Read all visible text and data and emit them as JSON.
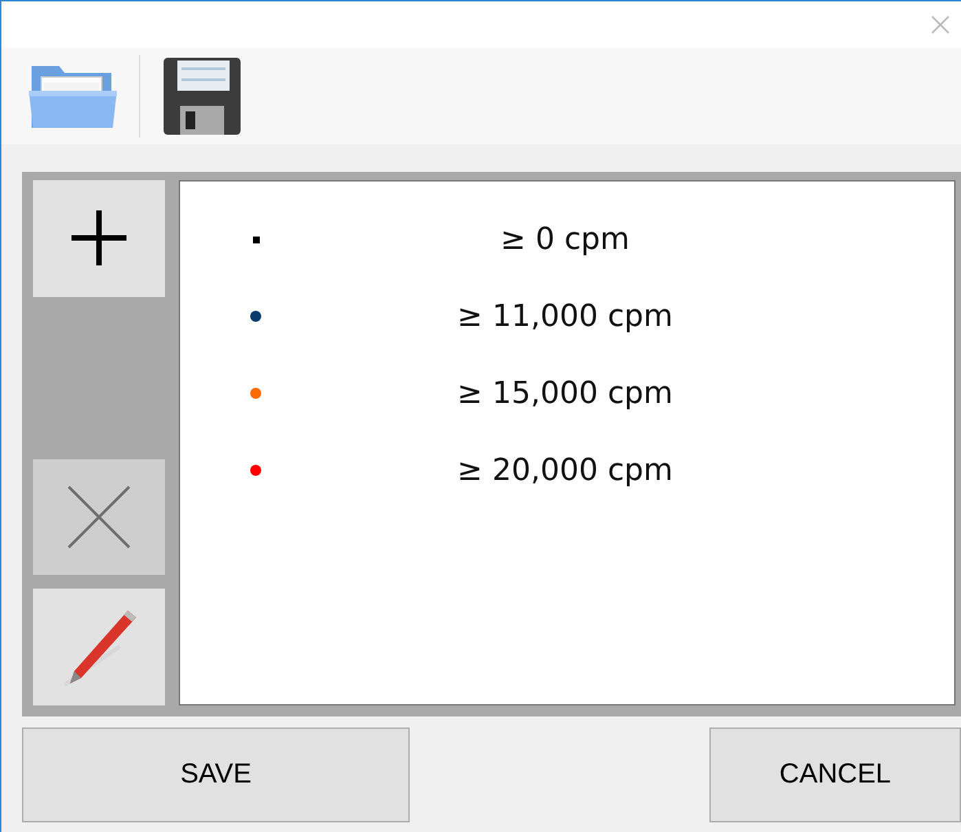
{
  "toolbar": {
    "buttons": [
      {
        "kind": "open"
      },
      {
        "kind": "save"
      }
    ]
  },
  "side_buttons": [
    {
      "kind": "add",
      "disabled": false
    },
    {
      "kind": "delete",
      "disabled": true
    },
    {
      "kind": "edit",
      "disabled": false
    }
  ],
  "levels": [
    {
      "label": "≥ 0 cpm",
      "color": "#000000",
      "kind": "square"
    },
    {
      "label": "≥ 11,000 cpm",
      "color": "#0b3a6e",
      "kind": "dot"
    },
    {
      "label": "≥ 15,000 cpm",
      "color": "#ff6a00",
      "kind": "dot"
    },
    {
      "label": "≥ 20,000 cpm",
      "color": "#ff0000",
      "kind": "dot"
    }
  ],
  "buttons": [
    {
      "label": "SAVE"
    },
    {
      "label": "CANCEL"
    }
  ]
}
